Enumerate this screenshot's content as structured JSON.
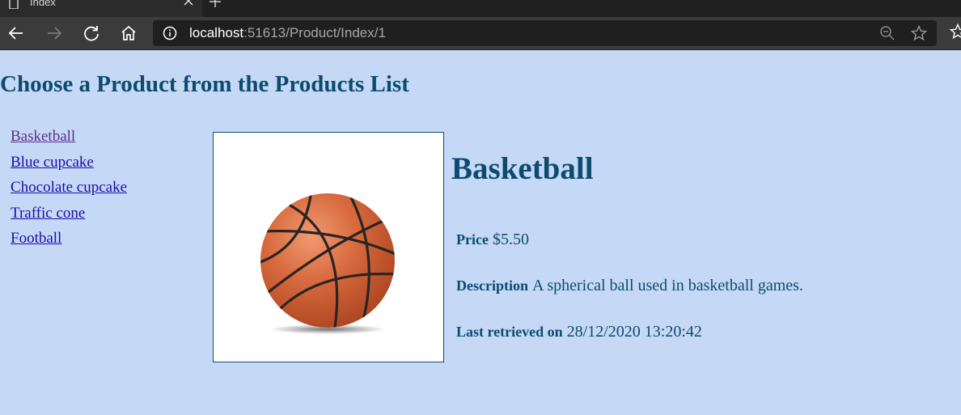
{
  "browser": {
    "tab_title": "Index",
    "url_host": "localhost",
    "url_rest": ":51613/Product/Index/1"
  },
  "page": {
    "title": "Choose a Product from the Products List"
  },
  "products": [
    {
      "name": "Basketball"
    },
    {
      "name": "Blue cupcake"
    },
    {
      "name": "Chocolate cupcake"
    },
    {
      "name": "Traffic cone"
    },
    {
      "name": "Football"
    }
  ],
  "selected": {
    "name": "Basketball",
    "price_label": "Price",
    "price": "$5.50",
    "description_label": "Description",
    "description": "A spherical ball used in basketball games.",
    "retrieved_label": "Last retrieved on",
    "retrieved": "28/12/2020 13:20:42"
  },
  "colors": {
    "page_bg": "#c5d9f7",
    "heading": "#0c4b6e",
    "link": "#1a0dab",
    "visited_link": "#5c2d91",
    "ball": "#d86a3e"
  },
  "icons": [
    "document-icon",
    "close-icon",
    "new-tab-icon",
    "back-icon",
    "forward-icon",
    "refresh-icon",
    "home-icon",
    "info-icon",
    "zoom-icon",
    "star-icon",
    "favorites-icon",
    "basketball-image"
  ]
}
